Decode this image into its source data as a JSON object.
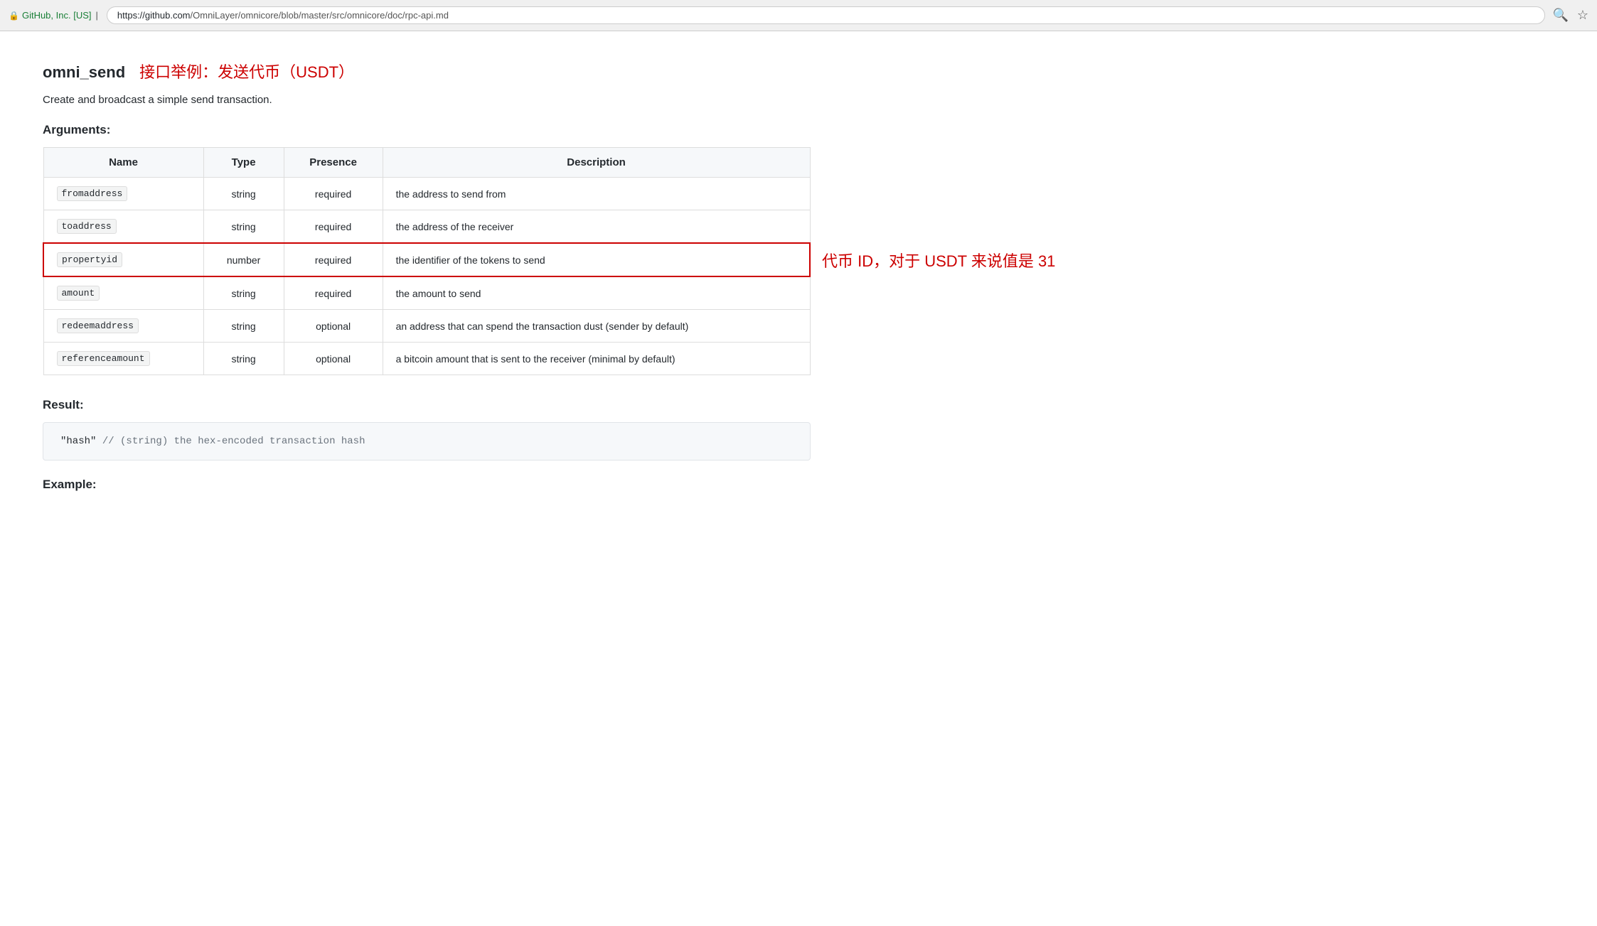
{
  "browser": {
    "security_label": "GitHub, Inc. [US]",
    "url_base": "https://github.com",
    "url_path": "/OmniLayer/omnicore/blob/master/src/omnicore/doc/rpc-api.md"
  },
  "page": {
    "api_name": "omni_send",
    "api_subtitle": "接口举例：发送代币（USDT）",
    "description": "Create and broadcast a simple send transaction.",
    "arguments_label": "Arguments:",
    "result_label": "Result:",
    "example_label": "Example:",
    "table": {
      "headers": {
        "name": "Name",
        "type": "Type",
        "presence": "Presence",
        "description": "Description"
      },
      "rows": [
        {
          "name": "fromaddress",
          "type": "string",
          "presence": "required",
          "description": "the address to send from",
          "highlighted": false
        },
        {
          "name": "toaddress",
          "type": "string",
          "presence": "required",
          "description": "the address of the receiver",
          "highlighted": false
        },
        {
          "name": "propertyid",
          "type": "number",
          "presence": "required",
          "description": "the identifier of the tokens to send",
          "highlighted": true,
          "annotation": "代币 ID，对于 USDT 来说值是 31"
        },
        {
          "name": "amount",
          "type": "string",
          "presence": "required",
          "description": "the amount to send",
          "highlighted": false
        },
        {
          "name": "redeemaddress",
          "type": "string",
          "presence": "optional",
          "description": "an address that can spend the transaction dust (sender by default)",
          "highlighted": false
        },
        {
          "name": "referenceamount",
          "type": "string",
          "presence": "optional",
          "description": "a bitcoin amount that is sent to the receiver (minimal by default)",
          "highlighted": false
        }
      ]
    },
    "result_code": "\"hash\"  // (string) the hex-encoded transaction hash"
  }
}
